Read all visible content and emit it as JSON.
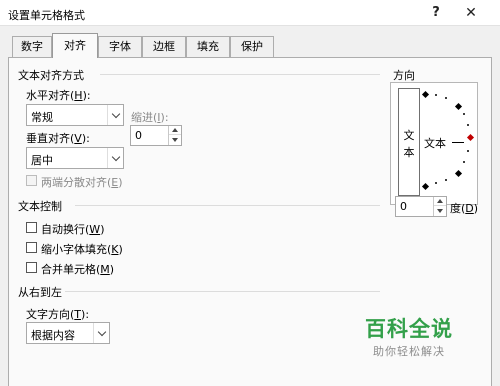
{
  "window": {
    "title": "设置单元格格式",
    "help_glyph": "?",
    "close_glyph": "✕"
  },
  "tabs": [
    {
      "label": "数字",
      "active": false
    },
    {
      "label": "对齐",
      "active": true
    },
    {
      "label": "字体",
      "active": false
    },
    {
      "label": "边框",
      "active": false
    },
    {
      "label": "填充",
      "active": false
    },
    {
      "label": "保护",
      "active": false
    }
  ],
  "text_alignment": {
    "group_title": "文本对齐方式",
    "horizontal": {
      "label": "水平对齐",
      "key": "H",
      "value": "常规"
    },
    "indent": {
      "label": "缩进",
      "key": "I",
      "value": "0"
    },
    "vertical": {
      "label": "垂直对齐",
      "key": "V",
      "value": "居中"
    },
    "distributed": {
      "label": "两端分散对齐",
      "key": "E",
      "checked": false,
      "enabled": false
    }
  },
  "text_control": {
    "group_title": "文本控制",
    "wrap": {
      "label": "自动换行",
      "key": "W",
      "checked": false
    },
    "shrink": {
      "label": "缩小字体填充",
      "key": "K",
      "checked": false
    },
    "merge": {
      "label": "合并单元格",
      "key": "M",
      "checked": false
    }
  },
  "rtl": {
    "group_title": "从右到左",
    "direction": {
      "label": "文字方向",
      "key": "T",
      "value": "根据内容"
    }
  },
  "orientation": {
    "group_title": "方向",
    "vertical_text": [
      "文",
      "本"
    ],
    "dial_text": "文本",
    "degrees": {
      "value": "0",
      "label": "度",
      "key": "D"
    }
  },
  "watermark": {
    "title": "百科全说",
    "subtitle": "助你轻松解决"
  },
  "colors": {
    "accent_diamond": "#c00000",
    "watermark_green": "#33a04a"
  }
}
